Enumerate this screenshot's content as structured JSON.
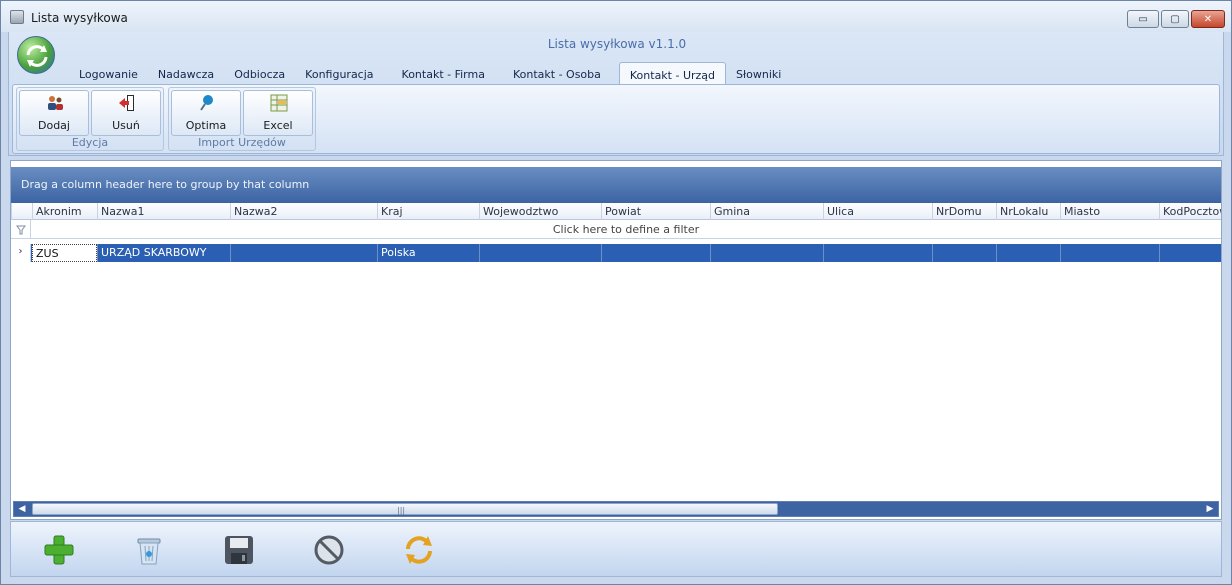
{
  "window": {
    "title": "Lista wysyłkowa",
    "controls": {
      "minimize": "▭",
      "maximize": "▢",
      "close": "✕"
    }
  },
  "ribbon": {
    "caption": "Lista wysyłkowa v1.1.0",
    "tabs": [
      {
        "label": "Logowanie"
      },
      {
        "label": "Nadawcza"
      },
      {
        "label": "Odbiocza"
      },
      {
        "label": "Konfiguracja"
      },
      {
        "label": "Kontakt - Firma"
      },
      {
        "label": "Kontakt - Osoba"
      },
      {
        "label": "Kontakt - Urząd"
      },
      {
        "label": "Słowniki"
      }
    ],
    "active_tab": "Kontakt - Urząd",
    "groups": [
      {
        "label": "Edycja",
        "buttons": [
          {
            "label": "Dodaj",
            "icon": "add-user-icon"
          },
          {
            "label": "Usuń",
            "icon": "remove-door-icon"
          }
        ]
      },
      {
        "label": "Import Urzędów",
        "buttons": [
          {
            "label": "Optima",
            "icon": "pin-icon"
          },
          {
            "label": "Excel",
            "icon": "spreadsheet-icon"
          }
        ]
      }
    ]
  },
  "grid": {
    "group_panel_text": "Drag a column header here to group by that column",
    "columns": [
      "Akronim",
      "Nazwa1",
      "Nazwa2",
      "Kraj",
      "Wojewodztwo",
      "Powiat",
      "Gmina",
      "Ulica",
      "NrDomu",
      "NrLokalu",
      "Miasto",
      "KodPocztow"
    ],
    "filter_text": "Click here to define a filter",
    "rows": [
      [
        "ZUS",
        "URZĄD SKARBOWY",
        "",
        "Polska",
        "",
        "",
        "",
        "",
        "",
        "",
        "",
        ""
      ]
    ],
    "selected_row": 0
  },
  "bottom_toolbar": {
    "buttons": [
      {
        "icon": "add-icon",
        "color": "#4caf32"
      },
      {
        "icon": "recycle-bin-icon",
        "color": "#7fa3c8"
      },
      {
        "icon": "save-icon",
        "color": "#4d5560"
      },
      {
        "icon": "cancel-icon",
        "color": "#555b63"
      },
      {
        "icon": "refresh-icon",
        "color": "#e3a21f"
      }
    ]
  }
}
